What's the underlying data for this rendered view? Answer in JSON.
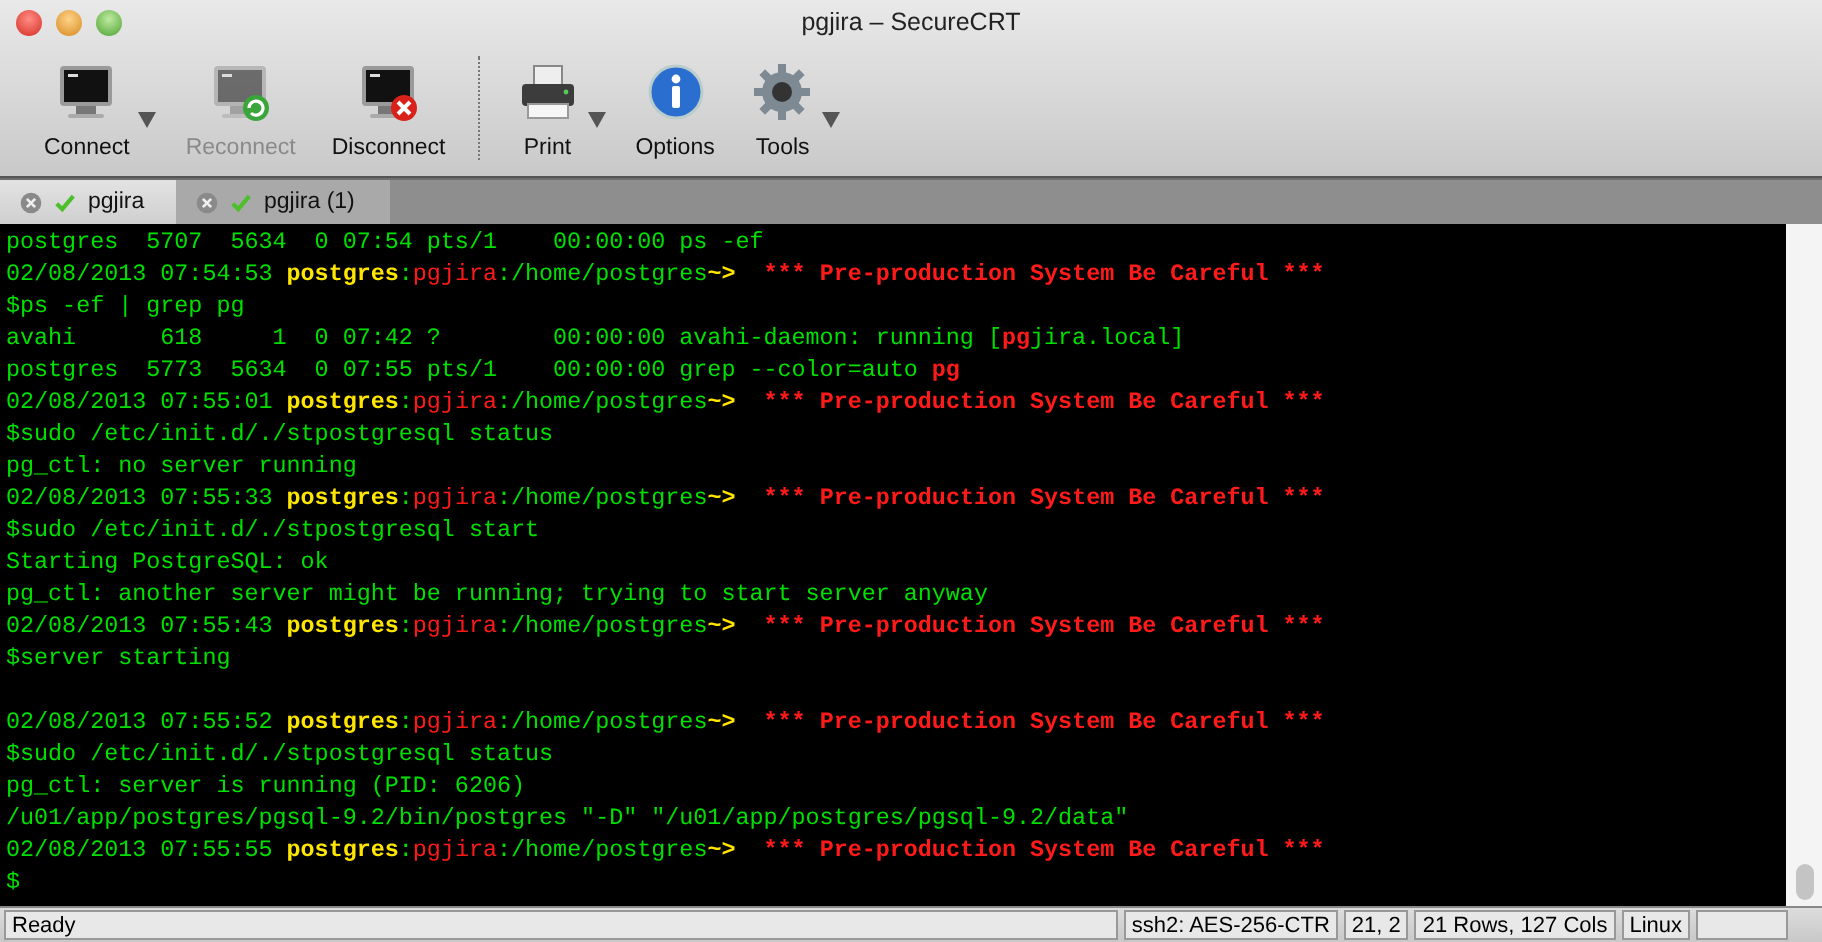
{
  "window": {
    "title": "pgjira – SecureCRT"
  },
  "toolbar": [
    {
      "kind": "button",
      "label": "Connect",
      "disabled": false,
      "has_menu": true
    },
    {
      "kind": "button",
      "label": "Reconnect",
      "disabled": true,
      "has_menu": false
    },
    {
      "kind": "button",
      "label": "Disconnect",
      "disabled": false,
      "has_menu": false
    },
    {
      "kind": "separator"
    },
    {
      "kind": "button",
      "label": "Print",
      "disabled": false,
      "has_menu": true
    },
    {
      "kind": "button",
      "label": "Options",
      "disabled": false,
      "has_menu": false
    },
    {
      "kind": "button",
      "label": "Tools",
      "disabled": false,
      "has_menu": true
    }
  ],
  "tabs": [
    {
      "label": "pgjira",
      "selected": true,
      "connected": true
    },
    {
      "label": "pgjira (1)",
      "selected": false,
      "connected": true
    }
  ],
  "terminal": {
    "lines": [
      {
        "kind": "text",
        "segments": [
          {
            "kind": "text",
            "text": "postgres  5707  5634  0 07:54 pts/1    00:00:00 ps -ef"
          }
        ]
      },
      {
        "kind": "text",
        "segments": [
          {
            "kind": "text",
            "text": "02/08/2013 07:54:53 "
          },
          {
            "kind": "user",
            "text": "postgres"
          },
          {
            "kind": "text",
            "text": ":"
          },
          {
            "kind": "host",
            "text": "pgjira"
          },
          {
            "kind": "text",
            "text": ":/home/postgres"
          },
          {
            "kind": "prompt",
            "text": "~>"
          },
          {
            "kind": "warning",
            "text": "*** Pre-production System Be Careful ***"
          }
        ]
      },
      {
        "kind": "text",
        "segments": [
          {
            "kind": "text",
            "text": "$ps -ef | grep pg"
          }
        ]
      },
      {
        "kind": "text",
        "segments": [
          {
            "kind": "text",
            "text": "avahi      618     1  0 07:42 ?        00:00:00 avahi-daemon: running ["
          },
          {
            "kind": "match",
            "text": "pg"
          },
          {
            "kind": "text",
            "text": "jira.local]"
          }
        ]
      },
      {
        "kind": "text",
        "segments": [
          {
            "kind": "text",
            "text": "postgres  5773  5634  0 07:55 pts/1    00:00:00 grep --color=auto "
          },
          {
            "kind": "match",
            "text": "pg"
          }
        ]
      },
      {
        "kind": "text",
        "segments": [
          {
            "kind": "text",
            "text": "02/08/2013 07:55:01 "
          },
          {
            "kind": "user",
            "text": "postgres"
          },
          {
            "kind": "text",
            "text": ":"
          },
          {
            "kind": "host",
            "text": "pgjira"
          },
          {
            "kind": "text",
            "text": ":/home/postgres"
          },
          {
            "kind": "prompt",
            "text": "~>"
          },
          {
            "kind": "warning",
            "text": "*** Pre-production System Be Careful ***"
          }
        ]
      },
      {
        "kind": "text",
        "segments": [
          {
            "kind": "text",
            "text": "$sudo /etc/init.d/./stpostgresql status"
          }
        ]
      },
      {
        "kind": "text",
        "segments": [
          {
            "kind": "text",
            "text": "pg_ctl: no server running"
          }
        ]
      },
      {
        "kind": "text",
        "segments": [
          {
            "kind": "text",
            "text": "02/08/2013 07:55:33 "
          },
          {
            "kind": "user",
            "text": "postgres"
          },
          {
            "kind": "text",
            "text": ":"
          },
          {
            "kind": "host",
            "text": "pgjira"
          },
          {
            "kind": "text",
            "text": ":/home/postgres"
          },
          {
            "kind": "prompt",
            "text": "~>"
          },
          {
            "kind": "warning",
            "text": "*** Pre-production System Be Careful ***"
          }
        ]
      },
      {
        "kind": "text",
        "segments": [
          {
            "kind": "text",
            "text": "$sudo /etc/init.d/./stpostgresql start"
          }
        ]
      },
      {
        "kind": "text",
        "segments": [
          {
            "kind": "text",
            "text": "Starting PostgreSQL: ok"
          }
        ]
      },
      {
        "kind": "text",
        "segments": [
          {
            "kind": "text",
            "text": "pg_ctl: another server might be running; trying to start server anyway"
          }
        ]
      },
      {
        "kind": "text",
        "segments": [
          {
            "kind": "text",
            "text": "02/08/2013 07:55:43 "
          },
          {
            "kind": "user",
            "text": "postgres"
          },
          {
            "kind": "text",
            "text": ":"
          },
          {
            "kind": "host",
            "text": "pgjira"
          },
          {
            "kind": "text",
            "text": ":/home/postgres"
          },
          {
            "kind": "prompt",
            "text": "~>"
          },
          {
            "kind": "warning",
            "text": "*** Pre-production System Be Careful ***"
          }
        ]
      },
      {
        "kind": "text",
        "segments": [
          {
            "kind": "text",
            "text": "$server starting"
          }
        ]
      },
      {
        "kind": "blank"
      },
      {
        "kind": "text",
        "segments": [
          {
            "kind": "text",
            "text": "02/08/2013 07:55:52 "
          },
          {
            "kind": "user",
            "text": "postgres"
          },
          {
            "kind": "text",
            "text": ":"
          },
          {
            "kind": "host",
            "text": "pgjira"
          },
          {
            "kind": "text",
            "text": ":/home/postgres"
          },
          {
            "kind": "prompt",
            "text": "~>"
          },
          {
            "kind": "warning",
            "text": "*** Pre-production System Be Careful ***"
          }
        ]
      },
      {
        "kind": "text",
        "segments": [
          {
            "kind": "text",
            "text": "$sudo /etc/init.d/./stpostgresql status"
          }
        ]
      },
      {
        "kind": "text",
        "segments": [
          {
            "kind": "text",
            "text": "pg_ctl: server is running (PID: 6206)"
          }
        ]
      },
      {
        "kind": "text",
        "segments": [
          {
            "kind": "text",
            "text": "/u01/app/postgres/pgsql-9.2/bin/postgres \"-D\" \"/u01/app/postgres/pgsql-9.2/data\""
          }
        ]
      },
      {
        "kind": "text",
        "segments": [
          {
            "kind": "text",
            "text": "02/08/2013 07:55:55 "
          },
          {
            "kind": "user",
            "text": "postgres"
          },
          {
            "kind": "text",
            "text": ":"
          },
          {
            "kind": "host",
            "text": "pgjira"
          },
          {
            "kind": "text",
            "text": ":/home/postgres"
          },
          {
            "kind": "prompt",
            "text": "~>"
          },
          {
            "kind": "warning",
            "text": "*** Pre-production System Be Careful ***"
          }
        ]
      },
      {
        "kind": "text",
        "segments": [
          {
            "kind": "text",
            "text": "$"
          }
        ]
      }
    ]
  },
  "status_bar": [
    "Ready",
    "ssh2: AES-256-CTR",
    "21, 2",
    "21 Rows, 127 Cols",
    "Linux"
  ]
}
